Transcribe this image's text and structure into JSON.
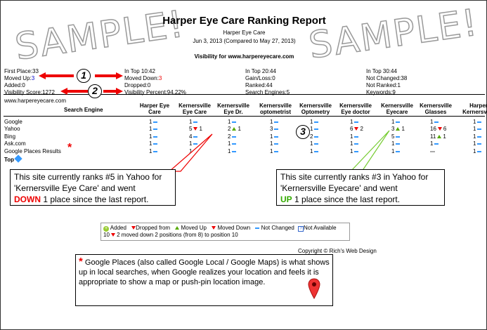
{
  "watermark": "SAMPLE!",
  "report": {
    "title": "Harper Eye Care Ranking Report",
    "subtitle": "Harper Eye Care",
    "date_range": "Jun 3, 2013 (Compared to May 27, 2013)",
    "visibility_label": "Visibility for www.harpereyecare.com"
  },
  "stats": {
    "first_place": "First Place:33",
    "moved_up_label": "Moved Up:",
    "moved_up_value": "3",
    "added": "Added:0",
    "visibility_score": "Visibility Score:1272",
    "in_top_10": "In Top 10:42",
    "moved_down_label": "Moved Down:",
    "moved_down_value": "3",
    "dropped": "Dropped:0",
    "visibility_percent": "Visibility Percent:94.22%",
    "in_top_20": "In Top 20:44",
    "gain_loss": "Gain/Loss:0",
    "ranked": "Ranked:44",
    "search_engines": "Search Engines:5",
    "in_top_30": "In Top 30:44",
    "not_changed": "Not Changed:38",
    "not_ranked": "Not Ranked:1",
    "keywords": "Keywords:9"
  },
  "badges": [
    "1",
    "2",
    "3"
  ],
  "site_url": "www.harpereyecare.com",
  "table": {
    "engine_header": "Search Engine",
    "columns": [
      [
        "Harper Eye",
        "Care"
      ],
      [
        "Kernersville",
        "Eye Care"
      ],
      [
        "Kernersville",
        "Eye Dr."
      ],
      [
        "Kernersville",
        "optometrist"
      ],
      [
        "Kernersville",
        "Optometry"
      ],
      [
        "Kernersville",
        "Eye doctor"
      ],
      [
        "Kernersville",
        "Eyecare"
      ],
      [
        "Kernersville",
        "Glasses"
      ],
      [
        "Harper",
        "Kernersville"
      ]
    ],
    "engines": [
      "Google",
      "Yahoo",
      "Bing",
      "Ask.com",
      "Google Places Results"
    ],
    "rows": [
      [
        [
          "1",
          "nc",
          ""
        ],
        [
          "1",
          "nc",
          ""
        ],
        [
          "1",
          "nc",
          ""
        ],
        [
          "1",
          "nc",
          ""
        ],
        [
          "1",
          "nc",
          ""
        ],
        [
          "1",
          "nc",
          ""
        ],
        [
          "1",
          "nc",
          ""
        ],
        [
          "1",
          "nc",
          ""
        ],
        [
          "1",
          "nc",
          ""
        ]
      ],
      [
        [
          "1",
          "nc",
          ""
        ],
        [
          "5",
          "dn",
          "1"
        ],
        [
          "2",
          "up",
          "1"
        ],
        [
          "3",
          "nc",
          ""
        ],
        [
          "1",
          "nc",
          ""
        ],
        [
          "6",
          "dn",
          "2"
        ],
        [
          "3",
          "up",
          "1"
        ],
        [
          "16",
          "dn",
          "6"
        ],
        [
          "1",
          "nc",
          ""
        ]
      ],
      [
        [
          "1",
          "nc",
          ""
        ],
        [
          "4",
          "nc",
          ""
        ],
        [
          "2",
          "nc",
          ""
        ],
        [
          "1",
          "nc",
          ""
        ],
        [
          "2",
          "nc",
          ""
        ],
        [
          "1",
          "nc",
          ""
        ],
        [
          "5",
          "nc",
          ""
        ],
        [
          "11",
          "up",
          "1"
        ],
        [
          "1",
          "nc",
          ""
        ]
      ],
      [
        [
          "1",
          "nc",
          ""
        ],
        [
          "1",
          "nc",
          ""
        ],
        [
          "1",
          "nc",
          ""
        ],
        [
          "1",
          "nc",
          ""
        ],
        [
          "1",
          "nc",
          ""
        ],
        [
          "1",
          "nc",
          ""
        ],
        [
          "1",
          "nc",
          ""
        ],
        [
          "1",
          "nc",
          ""
        ],
        [
          "1",
          "nc",
          ""
        ]
      ],
      [
        [
          "1",
          "nc",
          ""
        ],
        [
          "1",
          "nc",
          ""
        ],
        [
          "1",
          "nc",
          ""
        ],
        [
          "1",
          "nc",
          ""
        ],
        [
          "1",
          "nc",
          ""
        ],
        [
          "1",
          "nc",
          ""
        ],
        [
          "1",
          "nc",
          ""
        ],
        [
          "",
          "dash",
          ""
        ],
        [
          "1",
          "nc",
          ""
        ]
      ]
    ],
    "top_link": "Top"
  },
  "callout_yahoo_5": {
    "line1": "This site currently ranks #5 in Yahoo for",
    "line2": "'Kernersville Eye Care' and went",
    "emph": "DOWN",
    "line3": " 1 place since the last report."
  },
  "callout_yahoo_3": {
    "line1": "This site currently ranks #3 in Yahoo for",
    "line2": "'Kernersville Eyecare' and went",
    "emph": "UP",
    "line3": " 1 place since the last report."
  },
  "legend": {
    "added": "Added",
    "dropped": "Dropped from",
    "moved_up": "Moved Up",
    "moved_down": "Moved Down",
    "not_changed": "Not Changed",
    "not_available": "Not Available",
    "example_value": "10",
    "example_text": " 2 moved down 2 positions (from 8) to position 10"
  },
  "copyright": "Copyright © Rich's Web Design",
  "google_places_note": {
    "asterisk": "*",
    "text": "Google Places (also called Google Local / Google Maps) is what shows up in local searches, when Google realizes your location and feels it is appropriate to show a map or push-pin location image."
  },
  "colors": {
    "moved_down": "#ee0000",
    "moved_up": "#55aa00",
    "not_changed": "#3399ff",
    "callout_arrow_red": "#ff0000",
    "callout_arrow_green": "#77cc33"
  }
}
